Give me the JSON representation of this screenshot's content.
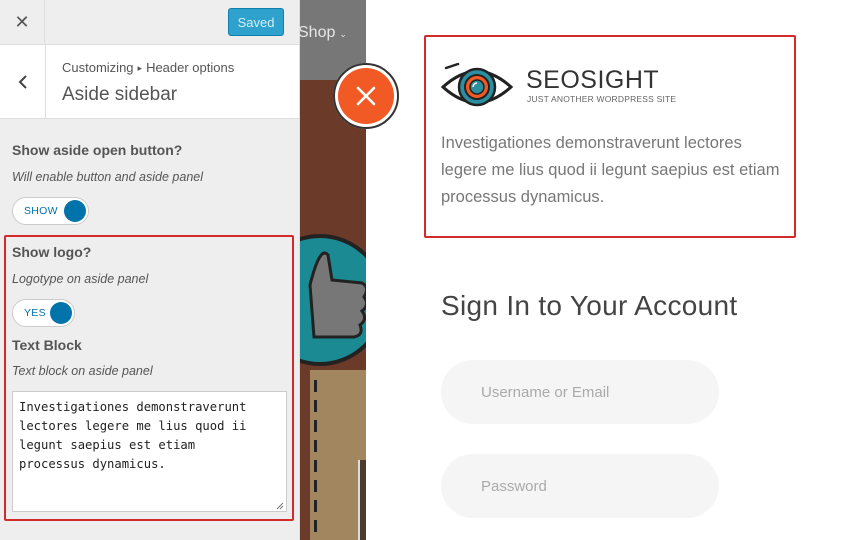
{
  "customizer": {
    "close_glyph": "✕",
    "save_label": "Saved",
    "breadcrumb": {
      "root": "Customizing",
      "separator": "▸",
      "parent": "Header options"
    },
    "section_title": "Aside sidebar",
    "controls": {
      "show_aside_button": {
        "label": "Show aside open button?",
        "description": "Will enable button and aside panel",
        "toggle_text": "SHOW",
        "enabled": true
      },
      "show_logo": {
        "label": "Show logo?",
        "description": "Logotype on aside panel",
        "toggle_text": "YES",
        "enabled": true
      },
      "text_block": {
        "label": "Text Block",
        "description": "Text block on aside panel",
        "value": "Investigationes demonstraverunt\nlectores legere me lius quod ii\nlegunt saepius est etiam\nprocessus dynamicus."
      }
    }
  },
  "preview": {
    "nav": {
      "shop_label": "Shop",
      "shop_caret": "⌄"
    },
    "aside": {
      "brand_name": "SEOSIGHT",
      "tagline": "JUST ANOTHER WORDPRESS SITE",
      "text": "Investigationes demonstraverunt lectores legere me lius quod ii legunt saepius est etiam processus dynamicus.",
      "signin_title": "Sign In to Your Account",
      "username_placeholder": "Username or Email",
      "password_placeholder": "Password"
    }
  },
  "colors": {
    "accent_blue": "#0073aa",
    "save_button": "#2ea2cc",
    "highlight_red": "#d12b2b",
    "close_orange": "#f15a24"
  },
  "icons": {
    "close": "close-icon",
    "back": "chevron-left-icon",
    "aside_close": "close-icon",
    "logo": "eye-logo-icon"
  }
}
